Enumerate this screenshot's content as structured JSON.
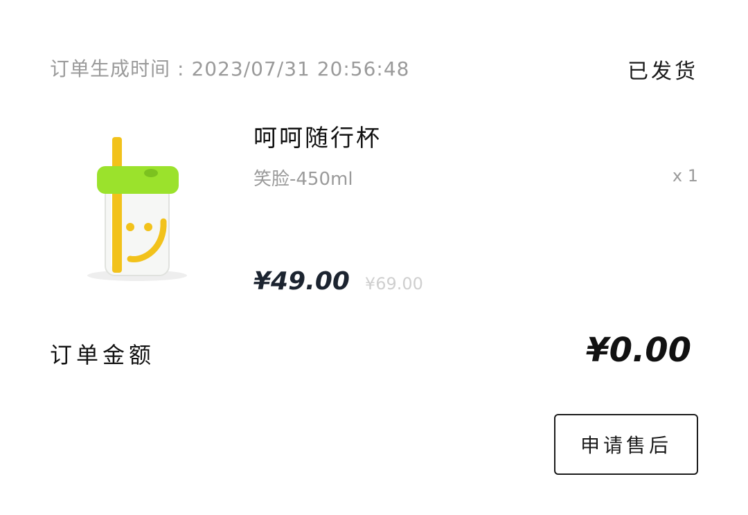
{
  "order": {
    "time_label": "订单生成时间",
    "time_separator": ":",
    "time_value": "2023/07/31 20:56:48",
    "status": "已发货"
  },
  "product": {
    "title": "呵呵随行杯",
    "variant": "笑脸-450ml",
    "quantity": "x 1",
    "price_current": "¥49.00",
    "price_original": "¥69.00",
    "image_icon": "smiley-cup-image"
  },
  "summary": {
    "amount_label": "订单金额",
    "amount_value": "¥0.00"
  },
  "actions": {
    "after_sales_label": "申请售后"
  },
  "colors": {
    "cup_lid": "#9be22c",
    "cup_accent": "#f2c21b",
    "muted_text": "#9a9a9a"
  }
}
